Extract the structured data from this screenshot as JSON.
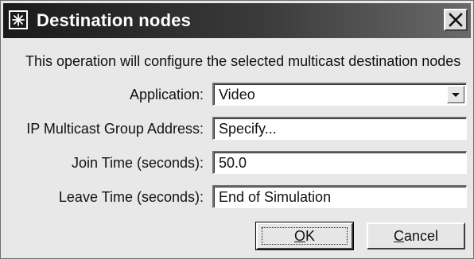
{
  "window": {
    "title": "Destination nodes",
    "icon": "asterisk-icon",
    "close_icon": "close-icon"
  },
  "description": "This operation will configure the selected multicast destination nodes",
  "fields": {
    "application": {
      "label": "Application:",
      "value": "Video"
    },
    "ip_multicast": {
      "label": "IP Multicast Group Address:",
      "value": "Specify..."
    },
    "join_time": {
      "label": "Join Time (seconds):",
      "value": "50.0"
    },
    "leave_time": {
      "label": "Leave Time (seconds):",
      "value": "End of Simulation"
    }
  },
  "buttons": {
    "ok": {
      "mnemonic": "O",
      "rest": "K"
    },
    "cancel": {
      "mnemonic": "C",
      "rest": "ancel"
    }
  }
}
